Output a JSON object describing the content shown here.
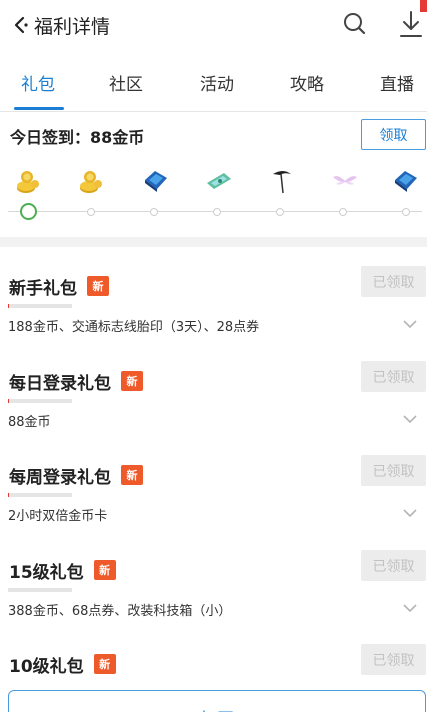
{
  "header": {
    "title": "福利详情",
    "back_icon": "chevron-left-icon",
    "search_icon": "search-icon",
    "download_icon": "download-icon"
  },
  "tabs": [
    {
      "label": "礼包",
      "active": true
    },
    {
      "label": "社区",
      "active": false
    },
    {
      "label": "活动",
      "active": false
    },
    {
      "label": "攻略",
      "active": false
    },
    {
      "label": "直播",
      "active": false
    }
  ],
  "checkin": {
    "title": "今日签到：88金币",
    "claim_label": "领取",
    "rewards": [
      {
        "icon": "gold-coins-icon"
      },
      {
        "icon": "gold-coins-icon"
      },
      {
        "icon": "blue-book-icon"
      },
      {
        "icon": "ticket-icon"
      },
      {
        "icon": "scythe-icon"
      },
      {
        "icon": "wings-icon"
      },
      {
        "icon": "blue-book-icon"
      }
    ],
    "current_day": 1
  },
  "gifts": [
    {
      "name": "新手礼包",
      "badge": "新",
      "desc": "188金币、交通标志线胎印（3天）、28点券",
      "button": "已领取",
      "progress": 0.02
    },
    {
      "name": "每日登录礼包",
      "badge": "新",
      "desc": "88金币",
      "button": "已领取",
      "progress": 0.02
    },
    {
      "name": "每周登录礼包",
      "badge": "新",
      "desc": "2小时双倍金币卡",
      "button": "已领取",
      "progress": 0.02
    },
    {
      "name": "15级礼包",
      "badge": "新",
      "desc": "388金币、68点券、改装科技箱（小）",
      "button": "已领取",
      "progress": 0.0
    },
    {
      "name": "10级礼包",
      "badge": "新",
      "desc": "",
      "button": "已领取",
      "progress": 0.0
    }
  ],
  "bottom": {
    "open_label": "打开"
  },
  "colors": {
    "accent": "#1a7fd4",
    "badge": "#ef5a2a",
    "progress_dot": "#4caf50"
  }
}
